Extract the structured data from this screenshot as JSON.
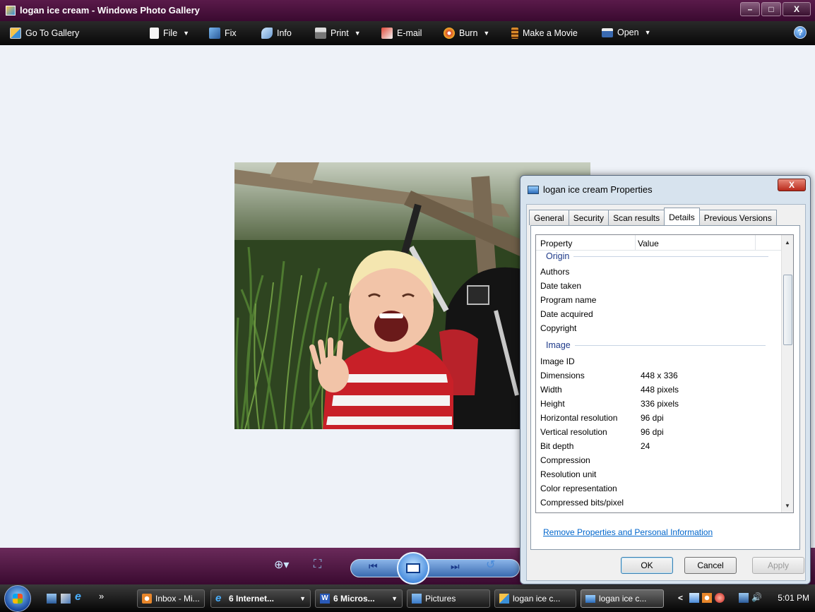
{
  "window": {
    "title": "logan ice cream - Windows Photo Gallery",
    "controls": [
      "–",
      "□",
      "X"
    ]
  },
  "toolbar": {
    "items": [
      {
        "label": "Go To Gallery",
        "icon": "gallery-icon"
      },
      {
        "label": "File",
        "icon": "file-icon",
        "dropdown": true
      },
      {
        "label": "Fix",
        "icon": "fix-icon"
      },
      {
        "label": "Info",
        "icon": "info-icon"
      },
      {
        "label": "Print",
        "icon": "print-icon",
        "dropdown": true
      },
      {
        "label": "E-mail",
        "icon": "email-icon"
      },
      {
        "label": "Burn",
        "icon": "burn-icon",
        "dropdown": true
      },
      {
        "label": "Make a Movie",
        "icon": "movie-icon"
      },
      {
        "label": "Open",
        "icon": "open-icon",
        "dropdown": true
      }
    ],
    "help": "?"
  },
  "photo": {
    "subject": "laughing toddler in a red and white striped shirt"
  },
  "dialog": {
    "title": "logan ice cream Properties",
    "close": "X",
    "tabs": [
      "General",
      "Security",
      "Scan results",
      "Details",
      "Previous Versions"
    ],
    "active_tab": "Details",
    "columns": [
      "Property",
      "Value"
    ],
    "groups": [
      {
        "name": "Origin",
        "rows": [
          {
            "property": "Authors",
            "value": ""
          },
          {
            "property": "Date taken",
            "value": ""
          },
          {
            "property": "Program name",
            "value": ""
          },
          {
            "property": "Date acquired",
            "value": ""
          },
          {
            "property": "Copyright",
            "value": ""
          }
        ]
      },
      {
        "name": "Image",
        "rows": [
          {
            "property": "Image ID",
            "value": ""
          },
          {
            "property": "Dimensions",
            "value": "448 x 336"
          },
          {
            "property": "Width",
            "value": "448 pixels"
          },
          {
            "property": "Height",
            "value": "336 pixels"
          },
          {
            "property": "Horizontal resolution",
            "value": "96 dpi"
          },
          {
            "property": "Vertical resolution",
            "value": "96 dpi"
          },
          {
            "property": "Bit depth",
            "value": "24"
          },
          {
            "property": "Compression",
            "value": ""
          },
          {
            "property": "Resolution unit",
            "value": ""
          },
          {
            "property": "Color representation",
            "value": ""
          },
          {
            "property": "Compressed bits/pixel",
            "value": ""
          }
        ]
      }
    ],
    "remove_link": "Remove Properties and Personal Information",
    "buttons": {
      "ok": "OK",
      "cancel": "Cancel",
      "apply": "Apply"
    }
  },
  "taskbar": {
    "overflow": "»",
    "tasks": [
      {
        "label": "Inbox - Mi...",
        "icon": "outlook-icon",
        "dropdown": false
      },
      {
        "label": "6 Internet...",
        "icon": "ie-icon",
        "dropdown": true,
        "bold": true
      },
      {
        "label": "6 Micros...",
        "icon": "word-icon",
        "dropdown": true,
        "bold": true
      },
      {
        "label": "Pictures",
        "icon": "folder-icon",
        "dropdown": false
      },
      {
        "label": "logan ice c...",
        "icon": "photo-gallery-icon",
        "dropdown": false
      },
      {
        "label": "logan ice c...",
        "icon": "properties-icon",
        "dropdown": false,
        "active": true
      }
    ],
    "tray_expand": "<",
    "clock": "5:01 PM"
  },
  "colors": {
    "window_frame": "#5a1a4a",
    "toolbar": "#111111",
    "viewer_bg": "#eef2f8",
    "link": "#0066cc",
    "group_header": "#1e3a8a"
  }
}
